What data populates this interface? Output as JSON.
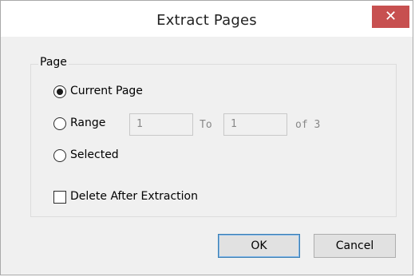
{
  "dialog": {
    "title": "Extract Pages",
    "close_glyph": "✕"
  },
  "page_group": {
    "label": "Page",
    "options": [
      {
        "label": "Current Page",
        "selected": true
      },
      {
        "label": "Range",
        "selected": false
      },
      {
        "label": "Selected",
        "selected": false
      }
    ],
    "range": {
      "from_value": "1",
      "to_label": "To",
      "to_value": "1",
      "of_label": "of 3"
    },
    "delete_after": {
      "label": "Delete After Extraction",
      "checked": false
    }
  },
  "buttons": {
    "ok": "OK",
    "cancel": "Cancel"
  },
  "colors": {
    "close_bg": "#c75050",
    "dialog_bg": "#f0f0f0",
    "default_border": "#3c7fb1"
  },
  "icons": {
    "close": "close-icon"
  }
}
